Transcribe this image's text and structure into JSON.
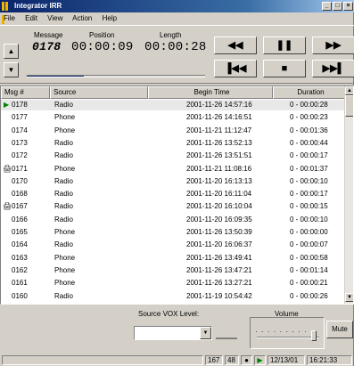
{
  "window": {
    "title": "Integrator IRR",
    "controls": [
      "_",
      "□",
      "×"
    ]
  },
  "menu": [
    "File",
    "Edit",
    "View",
    "Action",
    "Help"
  ],
  "transport": {
    "message_label": "Message",
    "position_label": "Position",
    "length_label": "Length",
    "message_value": "0178",
    "position_value": "00:00:09",
    "length_value": "00:00:28",
    "progress_fraction": 0.32,
    "buttons": {
      "rewind": "◀◀",
      "pause": "❚❚",
      "fast_forward": "▶▶",
      "skip_back": "▐◀◀",
      "stop": "■",
      "skip_forward": "▶▶▌"
    },
    "up_arrow": "▲",
    "down_arrow": "▼"
  },
  "list": {
    "headers": {
      "msg": "Msg #",
      "source": "Source",
      "begin": "Begin Time",
      "duration": "Duration"
    },
    "rows": [
      {
        "icon": "play",
        "msg": "0178",
        "source": "Radio",
        "begin": "2001-11-26 14:57:16",
        "duration": "0 - 00:00:28",
        "selected": true
      },
      {
        "icon": "",
        "msg": "0177",
        "source": "Phone",
        "begin": "2001-11-26 14:16:51",
        "duration": "0 - 00:00:23"
      },
      {
        "icon": "",
        "msg": "0174",
        "source": "Phone",
        "begin": "2001-11-21 11:12:47",
        "duration": "0 - 00:01:36"
      },
      {
        "icon": "",
        "msg": "0173",
        "source": "Radio",
        "begin": "2001-11-26 13:52:13",
        "duration": "0 - 00:00:44"
      },
      {
        "icon": "",
        "msg": "0172",
        "source": "Radio",
        "begin": "2001-11-26 13:51:51",
        "duration": "0 - 00:00:17"
      },
      {
        "icon": "lock",
        "msg": "0171",
        "source": "Phone",
        "begin": "2001-11-21 11:08:16",
        "duration": "0 - 00:01:37"
      },
      {
        "icon": "",
        "msg": "0170",
        "source": "Radio",
        "begin": "2001-11-20 16:13:13",
        "duration": "0 - 00:00:10"
      },
      {
        "icon": "",
        "msg": "0168",
        "source": "Radio",
        "begin": "2001-11-20 16:11:04",
        "duration": "0 - 00:00:17"
      },
      {
        "icon": "lock",
        "msg": "0167",
        "source": "Radio",
        "begin": "2001-11-20 16:10:04",
        "duration": "0 - 00:00:15"
      },
      {
        "icon": "",
        "msg": "0166",
        "source": "Radio",
        "begin": "2001-11-20 16:09:35",
        "duration": "0 - 00:00:10"
      },
      {
        "icon": "",
        "msg": "0165",
        "source": "Phone",
        "begin": "2001-11-26 13:50:39",
        "duration": "0 - 00:00:00"
      },
      {
        "icon": "",
        "msg": "0164",
        "source": "Radio",
        "begin": "2001-11-20 16:06:37",
        "duration": "0 - 00:00:07"
      },
      {
        "icon": "",
        "msg": "0163",
        "source": "Phone",
        "begin": "2001-11-26 13:49:41",
        "duration": "0 - 00:00:58"
      },
      {
        "icon": "",
        "msg": "0162",
        "source": "Phone",
        "begin": "2001-11-26 13:47:21",
        "duration": "0 - 00:01:14"
      },
      {
        "icon": "",
        "msg": "0161",
        "source": "Phone",
        "begin": "2001-11-26 13:27:21",
        "duration": "0 - 00:00:21"
      },
      {
        "icon": "",
        "msg": "0160",
        "source": "Radio",
        "begin": "2001-11-19 10:54:42",
        "duration": "0 - 00:00:26"
      }
    ]
  },
  "controls": {
    "vox_label": "Source VOX Level:",
    "volume_label": "Volume",
    "volume_ticks": "· · · · · · · · · ·",
    "volume_level": 0.95,
    "mute_label": "Mute"
  },
  "status": {
    "count": "167",
    "count2": "48",
    "date": "12/13/01",
    "time": "16:21:33"
  }
}
